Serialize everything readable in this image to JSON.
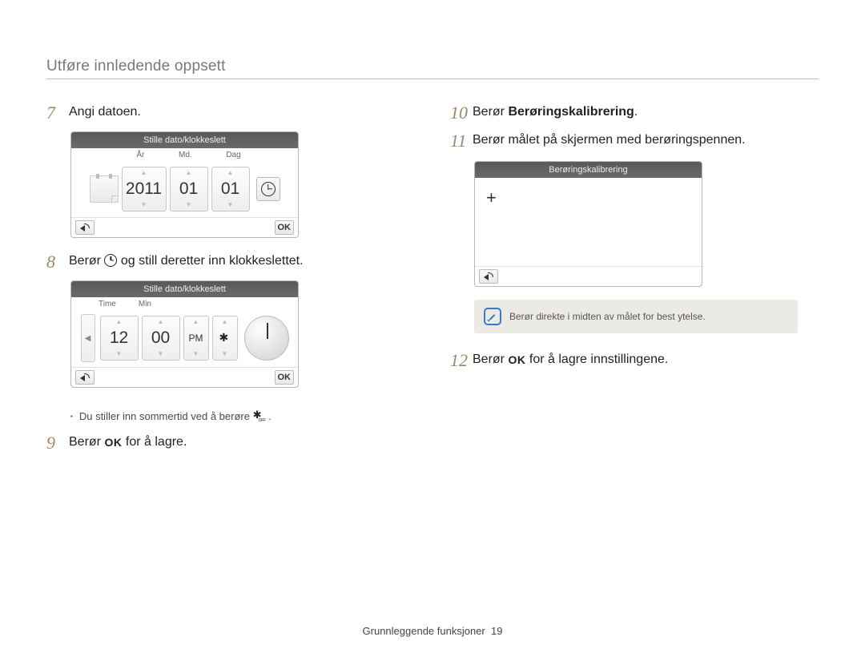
{
  "section_title": "Utføre innledende oppsett",
  "steps": {
    "s7": {
      "num": "7",
      "text": "Angi datoen."
    },
    "s8": {
      "num": "8",
      "pre": "Berør ",
      "post": " og still deretter inn klokkeslettet."
    },
    "s9": {
      "num": "9",
      "pre": "Berør ",
      "ok": "OK",
      "post": "  for å lagre."
    },
    "s10": {
      "num": "10",
      "pre": "Berør ",
      "bold": "Berøringskalibrering",
      "post": "."
    },
    "s11": {
      "num": "11",
      "text": "Berør målet på skjermen med berøringspennen."
    },
    "s12": {
      "num": "12",
      "pre": "Berør ",
      "ok": "OK",
      "post": "  for å lagre innstillingene."
    }
  },
  "device_date": {
    "title": "Stille dato/klokkeslett",
    "labels": {
      "year": "År",
      "month": "Md.",
      "day": "Dag"
    },
    "values": {
      "year": "2011",
      "month": "01",
      "day": "01"
    },
    "ok": "OK"
  },
  "device_time": {
    "title": "Stille dato/klokkeslett",
    "labels": {
      "hour": "Time",
      "min": "Min"
    },
    "values": {
      "hour": "12",
      "min": "00",
      "ampm": "PM"
    },
    "ok": "OK"
  },
  "dst_note": {
    "text": "Du stiller inn sommertid ved å berøre ",
    "post": " ."
  },
  "device_calibration": {
    "title": "Berøringskalibrering"
  },
  "callout": "Berør direkte i midten av målet for best ytelse.",
  "footer": {
    "text": "Grunnleggende funksjoner",
    "page": "19"
  }
}
